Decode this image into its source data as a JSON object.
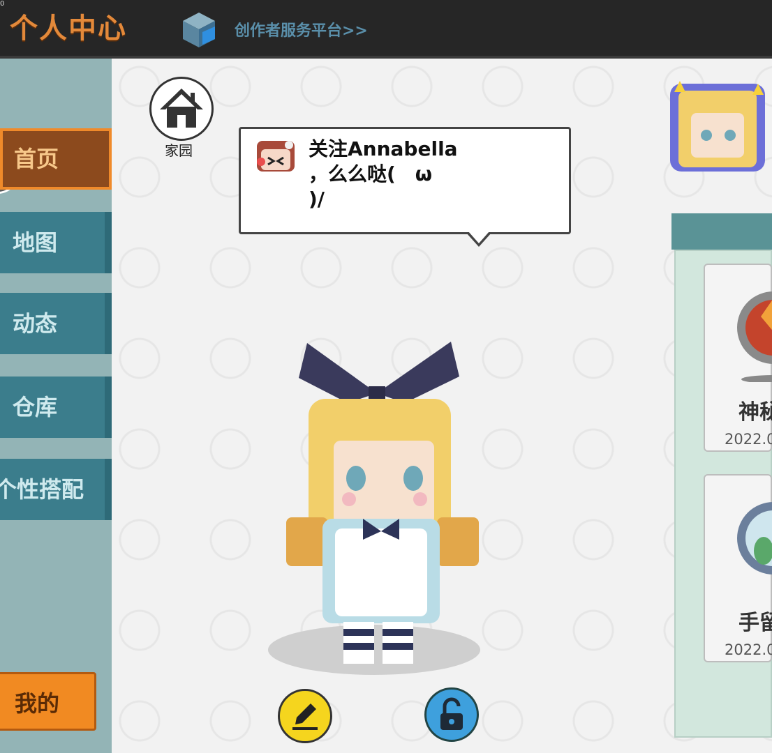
{
  "header": {
    "title": "个人中心",
    "platform_link": "创作者服务平台>>",
    "corner_mark": "0"
  },
  "sidebar": {
    "items": [
      {
        "label": "首页",
        "active": true
      },
      {
        "label": "地图",
        "active": false
      },
      {
        "label": "动态",
        "active": false
      },
      {
        "label": "仓库",
        "active": false
      },
      {
        "label": "个性搭配",
        "active": false
      }
    ],
    "mine_label": "我的"
  },
  "main": {
    "home_label": "家园",
    "speech_lines": [
      "关注Annabella",
      "，么么哒(　ω",
      ")/"
    ]
  },
  "cards": [
    {
      "name": "神秘",
      "date": "2022.0"
    },
    {
      "name": "手留",
      "date": "2022.0"
    }
  ],
  "colors": {
    "accent_orange": "#f08a2a",
    "nav_teal": "#3b7d8c",
    "edit_yellow": "#f5d51e",
    "lock_blue": "#3ea0dd"
  },
  "icons": [
    "house-icon",
    "pencil-icon",
    "unlock-icon",
    "cube-logo-icon"
  ]
}
